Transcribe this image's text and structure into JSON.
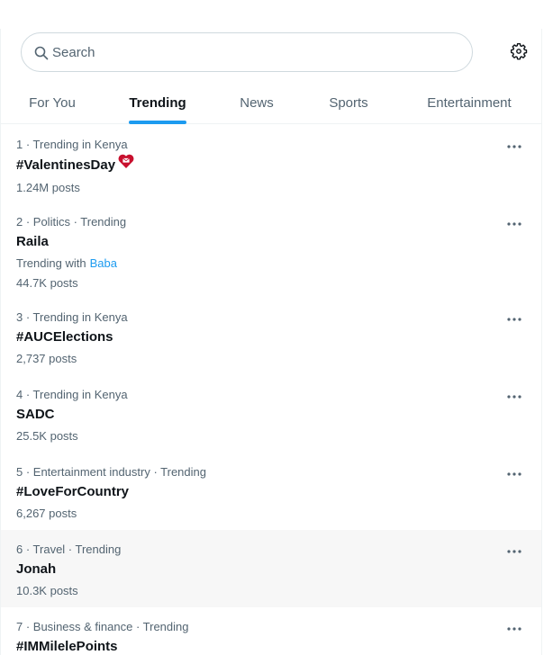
{
  "search": {
    "placeholder": "Search",
    "value": ""
  },
  "tabs": [
    {
      "label": "For You",
      "active": false
    },
    {
      "label": "Trending",
      "active": true
    },
    {
      "label": "News",
      "active": false
    },
    {
      "label": "Sports",
      "active": false
    },
    {
      "label": "Entertainment",
      "active": false
    }
  ],
  "trends": [
    {
      "meta": "1 · Trending in Kenya",
      "name": "#ValentinesDay",
      "count": "1.24M posts",
      "emoji": "heart-icon"
    },
    {
      "meta": "2 · Politics · Trending",
      "name": "Raila",
      "sub_prefix": "Trending with",
      "sub_link": "Baba",
      "count": "44.7K posts"
    },
    {
      "meta": "3 · Trending in Kenya",
      "name": "#AUCElections",
      "count": "2,737 posts"
    },
    {
      "meta": "4 · Trending in Kenya",
      "name": "SADC",
      "count": "25.5K posts"
    },
    {
      "meta": "5 · Entertainment industry · Trending",
      "name": "#LoveForCountry",
      "count": "6,267 posts"
    },
    {
      "meta": "6 · Travel · Trending",
      "name": "Jonah",
      "count": "10.3K posts",
      "hovered": true
    },
    {
      "meta": "7 · Business & finance · Trending",
      "name": "#IMMilelePoints"
    }
  ],
  "colors": {
    "accent": "#1d9bf0",
    "text_primary": "#0f1419",
    "text_secondary": "#536471",
    "hover_bg": "#f7f7f7"
  }
}
